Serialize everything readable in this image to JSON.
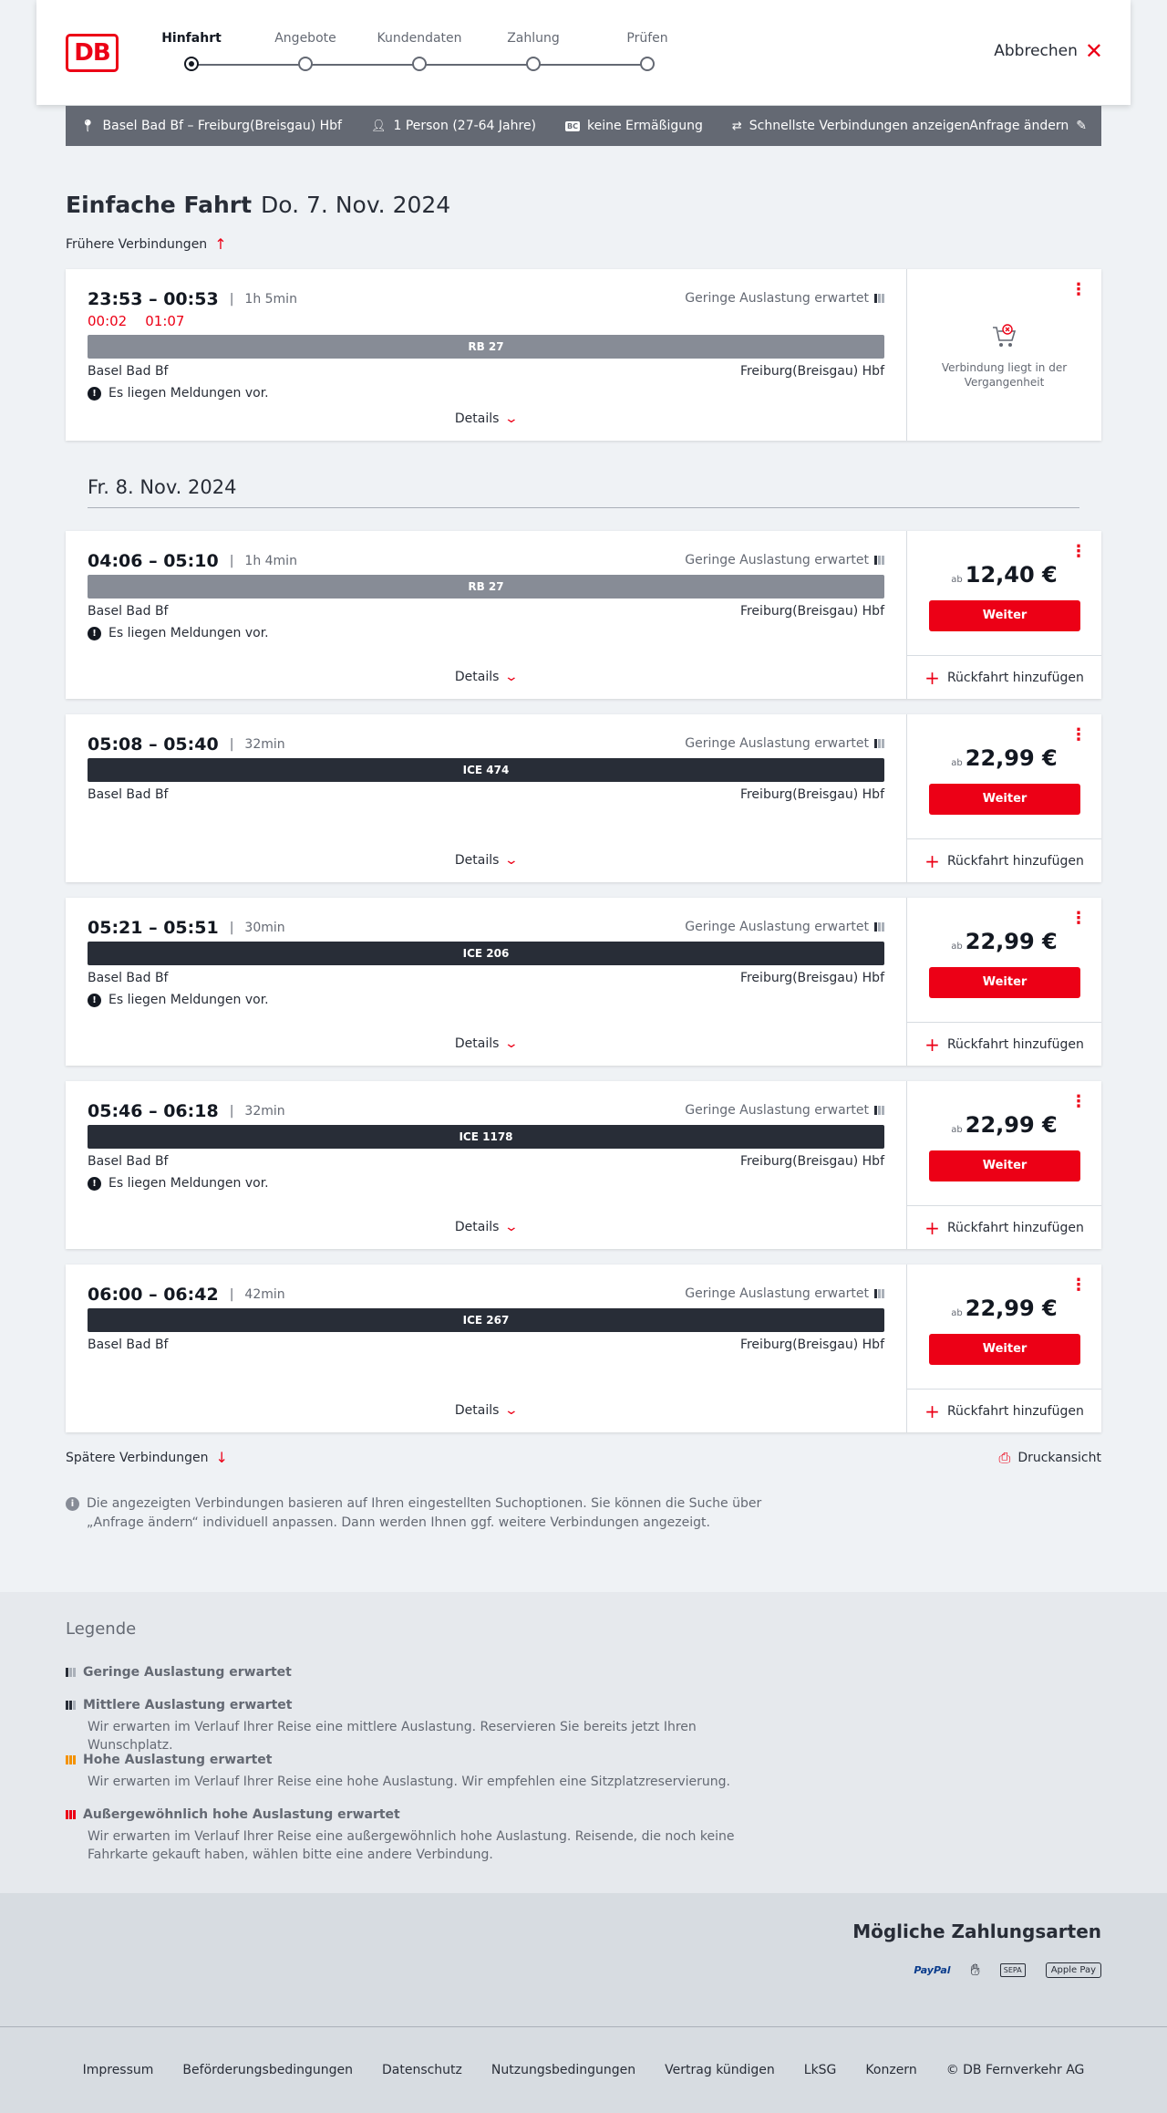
{
  "header": {
    "steps": [
      "Hinfahrt",
      "Angebote",
      "Kundendaten",
      "Zahlung",
      "Prüfen"
    ],
    "active_step": 0,
    "abort_label": "Abbrechen",
    "logo_text": "DB"
  },
  "summary": {
    "route": "Basel Bad Bf – Freiburg(Breisgau) Hbf",
    "persons": "1 Person (27-64 Jahre)",
    "discount": "keine Ermäßigung",
    "discount_badge": "BC",
    "fastest": "Schnellste Verbindungen anzeigen",
    "change": "Anfrage ändern"
  },
  "title": {
    "trip_type": "Einfache Fahrt",
    "date": "Do. 7. Nov. 2024"
  },
  "earlier_label": "Frühere Verbindungen",
  "second_date": "Fr. 8. Nov. 2024",
  "occupancy_text": "Geringe Auslastung erwartet",
  "details_label": "Details",
  "weiter_label": "Weiter",
  "return_label": "Rückfahrt hinzufügen",
  "price_prefix": "ab",
  "messages_text": "Es liegen Meldungen vor.",
  "connections": [
    {
      "time": "23:53 – 00:53",
      "duration": "1h 5min",
      "delay_dep": "00:02",
      "delay_arr": "01:07",
      "train": "RB 27",
      "from": "Basel Bad Bf",
      "to": "Freiburg(Breisgau) Hbf",
      "has_message": true,
      "past_text": "Verbindung liegt in der Vergangenheit"
    },
    {
      "time": "04:06 – 05:10",
      "duration": "1h 4min",
      "train": "RB 27",
      "from": "Basel Bad Bf",
      "to": "Freiburg(Breisgau) Hbf",
      "has_message": true,
      "price": "12,40 €"
    },
    {
      "time": "05:08 – 05:40",
      "duration": "32min",
      "train": "ICE 474",
      "from": "Basel Bad Bf",
      "to": "Freiburg(Breisgau) Hbf",
      "has_message": false,
      "price": "22,99 €"
    },
    {
      "time": "05:21 – 05:51",
      "duration": "30min",
      "train": "ICE 206",
      "from": "Basel Bad Bf",
      "to": "Freiburg(Breisgau) Hbf",
      "has_message": true,
      "price": "22,99 €"
    },
    {
      "time": "05:46 – 06:18",
      "duration": "32min",
      "train": "ICE 1178",
      "from": "Basel Bad Bf",
      "to": "Freiburg(Breisgau) Hbf",
      "has_message": true,
      "price": "22,99 €"
    },
    {
      "time": "06:00 – 06:42",
      "duration": "42min",
      "train": "ICE 267",
      "from": "Basel Bad Bf",
      "to": "Freiburg(Breisgau) Hbf",
      "has_message": false,
      "price": "22,99 €"
    }
  ],
  "later_label": "Spätere Verbindungen",
  "print_label": "Druckansicht",
  "info_text": "Die angezeigten Verbindungen basieren auf Ihren eingestellten Suchoptionen. Sie können die Suche über „Anfrage ändern“ individuell anpassen. Dann werden Ihnen ggf. weitere Verbindungen angezeigt.",
  "legend": {
    "title": "Legende",
    "items": [
      {
        "title": "Geringe Auslastung erwartet",
        "text": ""
      },
      {
        "title": "Mittlere Auslastung erwartet",
        "text": "Wir erwarten im Verlauf Ihrer Reise eine mittlere Auslastung. Reservieren Sie bereits jetzt Ihren Wunschplatz."
      },
      {
        "title": "Hohe Auslastung erwartet",
        "text": "Wir erwarten im Verlauf Ihrer Reise eine hohe Auslastung. Wir empfehlen eine Sitzplatzreservierung."
      },
      {
        "title": "Außergewöhnlich hohe Auslastung erwartet",
        "text": "Wir erwarten im Verlauf Ihrer Reise eine außergewöhnlich hohe Auslastung. Reisende, die noch keine Fahrkarte gekauft haben, wählen bitte eine andere Verbindung."
      }
    ]
  },
  "payment": {
    "title": "Mögliche Zahlungsarten",
    "methods": [
      "PayPal",
      "SEPA",
      "Apple Pay"
    ]
  },
  "footer": [
    "Impressum",
    "Beförderungsbedingungen",
    "Datenschutz",
    "Nutzungsbedingungen",
    "Vertrag kündigen",
    "LkSG",
    "Konzern",
    "© DB Fernverkehr AG"
  ]
}
